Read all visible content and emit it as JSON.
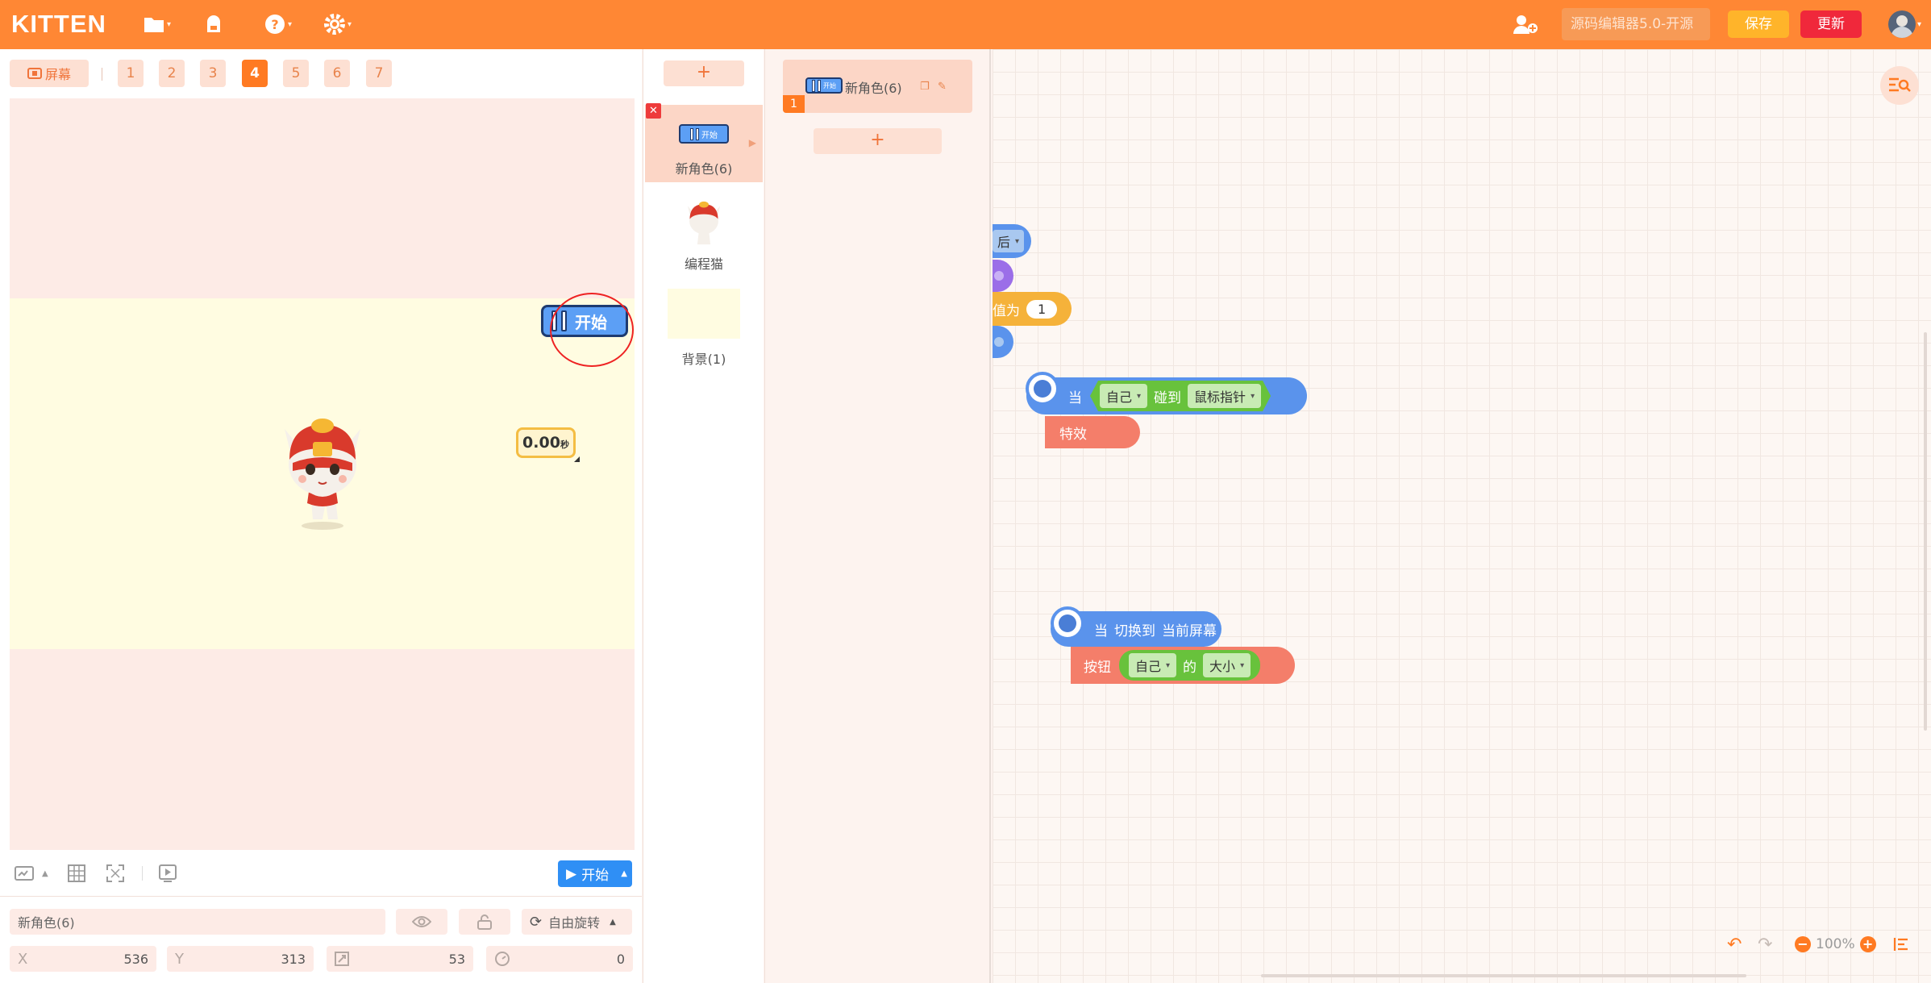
{
  "app": {
    "logo": "KITTEN"
  },
  "header": {
    "project_name": "源码编辑器5.0-开源",
    "save_label": "保存",
    "update_label": "更新"
  },
  "scene_bar": {
    "screen_label": "屏幕",
    "tabs": [
      "1",
      "2",
      "3",
      "4",
      "5",
      "6",
      "7"
    ],
    "active_tab": "4"
  },
  "stage": {
    "start_button_label": "开始",
    "timer_value": "0.00",
    "timer_unit": "秒"
  },
  "stage_controls": {
    "run_label": "开始"
  },
  "sprite_props": {
    "name": "新角色(6)",
    "rotation_mode": "自由旋转",
    "x_label": "X",
    "x": "536",
    "y_label": "Y",
    "y": "313",
    "size": "53",
    "direction": "0"
  },
  "sprite_list": {
    "add_label": "+",
    "items": [
      {
        "name": "新角色(6)",
        "thumb_label": "开始"
      },
      {
        "name": "编程猫"
      },
      {
        "name": "背景(1)"
      }
    ]
  },
  "script_list": {
    "items": [
      {
        "name": "新角色(6)",
        "index": "1",
        "thumb_label": "开始"
      }
    ],
    "add_label": "+"
  },
  "workspace": {
    "partial_dropdown_text": "后",
    "partial_set_text": "值为",
    "partial_set_value": "1",
    "block1": {
      "when": "当",
      "self": "自己",
      "touch": "碰到",
      "target": "鼠标指针",
      "effect": "特效"
    },
    "block2": {
      "when": "当",
      "switch_to": "切换到",
      "current_screen": "当前屏幕",
      "button": "按钮",
      "self": "自己",
      "of": "的",
      "size": "大小"
    },
    "zoom_level": "100%"
  }
}
